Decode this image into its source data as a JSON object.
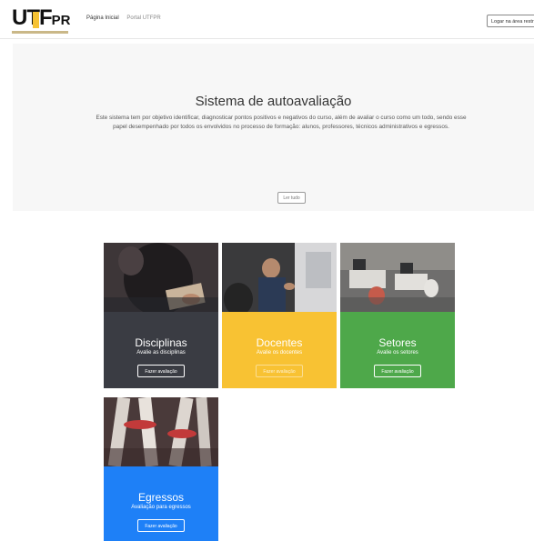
{
  "header": {
    "logo_text_u": "U",
    "logo_text_tf": "TF",
    "logo_text_pr": "PR",
    "nav_home": "Página Inicial",
    "nav_portal": "Portal UTFPR",
    "login": "Logar na área restrita"
  },
  "hero": {
    "title": "Sistema de autoavaliação",
    "description": "Este sistema tem por objetivo identificar, diagnosticar pontos positivos e negativos do curso, além de avaliar o curso como um todo, sendo esse papel desempenhado por todos os envolvidos no processo de formação: alunos, professores, técnicos administrativos e egressos.",
    "read_more": "Ler tudo"
  },
  "cards": [
    {
      "title": "Disciplinas",
      "subtitle": "Avalie as disciplinas",
      "button": "Fazer avaliação",
      "color": "#3a3c43"
    },
    {
      "title": "Docentes",
      "subtitle": "Avalie os docentes",
      "button": "Fazer avaliação",
      "color": "#f8c233"
    },
    {
      "title": "Setores",
      "subtitle": "Avalie os setores",
      "button": "Fazer avaliação",
      "color": "#4ea84a"
    },
    {
      "title": "Egressos",
      "subtitle": "Avaliação para egressos",
      "button": "Fazer avaliação",
      "color": "#1e80f7"
    }
  ]
}
